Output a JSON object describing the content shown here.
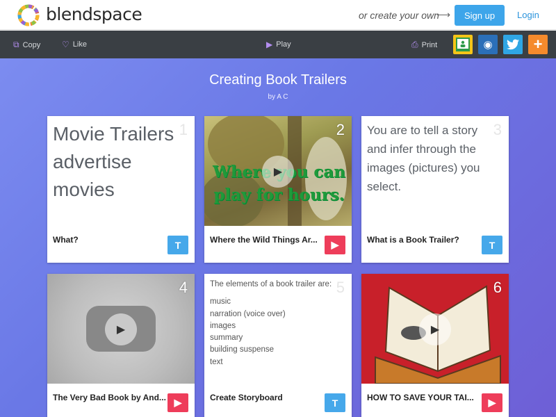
{
  "header": {
    "brand": "blendspace",
    "or_create": "or create your own",
    "signup": "Sign up",
    "login": "Login"
  },
  "toolbar": {
    "copy": "Copy",
    "like": "Like",
    "play": "Play",
    "print": "Print"
  },
  "lesson": {
    "title": "Creating Book Trailers",
    "author": "by A C"
  },
  "cards": [
    {
      "num": "1",
      "type": "text",
      "caption": "What?",
      "body": "Movie Trailers advertise movies"
    },
    {
      "num": "2",
      "type": "video",
      "caption": "Where the Wild Things Ar...",
      "overlay": "Where you can play for hours."
    },
    {
      "num": "3",
      "type": "text",
      "caption": "What is a Book Trailer?",
      "body": "You are to tell a story and infer through the images (pictures) you select."
    },
    {
      "num": "4",
      "type": "video",
      "caption": "The Very Bad Book by And..."
    },
    {
      "num": "5",
      "type": "text",
      "caption": "Create Storyboard",
      "intro": "The elements of a book trailer are:",
      "items": [
        "music",
        "narration (voice over)",
        "images",
        "summary",
        "building suspense",
        "text"
      ]
    },
    {
      "num": "6",
      "type": "video",
      "caption": "HOW TO SAVE YOUR TAI..."
    }
  ],
  "colors": {
    "accent_blue": "#3da5ea",
    "video_red": "#ee3d5a",
    "toolbar_bg": "#3a3f44"
  }
}
